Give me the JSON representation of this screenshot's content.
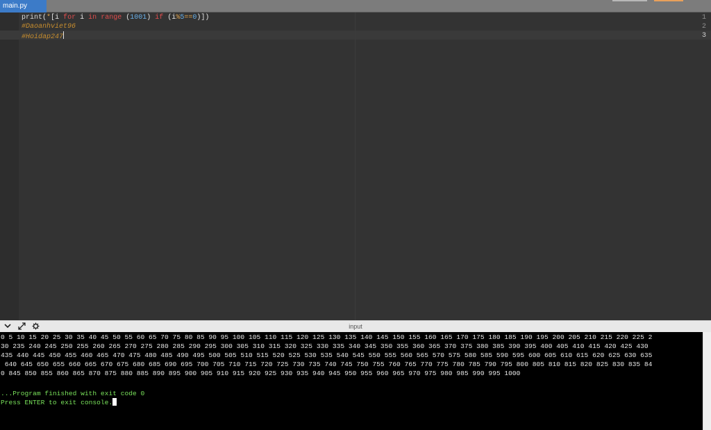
{
  "tabs": [
    {
      "label": "main.py",
      "active": true
    }
  ],
  "editor": {
    "line_numbers": [
      "1",
      "2",
      "3"
    ],
    "line1": {
      "print": "print",
      "open": "(",
      "star": "*",
      "bracket_open": "[",
      "i1": "i",
      "for": "for",
      "i2": "i",
      "in": "in",
      "range": "range",
      "paren_open": "(",
      "num1001": "1001",
      "paren_close": ")",
      "if": "if",
      "paren_open2": "(",
      "i3": "i",
      "mod": "%",
      "num5": "5",
      "eq": "==",
      "num0": "0",
      "close_all": ")])"
    },
    "line2": "#Daoanhviet96",
    "line3": "#Hoidap247"
  },
  "console": {
    "title": "input",
    "icons": [
      "chevron-down-icon",
      "expand-icon",
      "settings-icon"
    ],
    "output_lines": [
      "0 5 10 15 20 25 30 35 40 45 50 55 60 65 70 75 80 85 90 95 100 105 110 115 120 125 130 135 140 145 150 155 160 165 170 175 180 185 190 195 200 205 210 215 220 225 2",
      "30 235 240 245 250 255 260 265 270 275 280 285 290 295 300 305 310 315 320 325 330 335 340 345 350 355 360 365 370 375 380 385 390 395 400 405 410 415 420 425 430",
      "435 440 445 450 455 460 465 470 475 480 485 490 495 500 505 510 515 520 525 530 535 540 545 550 555 560 565 570 575 580 585 590 595 600 605 610 615 620 625 630 635",
      " 640 645 650 655 660 665 670 675 680 685 690 695 700 705 710 715 720 725 730 735 740 745 750 755 760 765 770 775 780 785 790 795 800 805 810 815 820 825 830 835 84",
      "0 845 850 855 860 865 870 875 880 885 890 895 900 905 910 915 920 925 930 935 940 945 950 955 960 965 970 975 980 985 990 995 1000"
    ],
    "finished": "...Program finished with exit code 0",
    "press_enter": "Press ENTER to exit console."
  },
  "colors": {
    "tab_active": "#3c7bc8",
    "editor_bg": "#333333",
    "console_bg": "#000000",
    "console_green": "#78e05a"
  }
}
